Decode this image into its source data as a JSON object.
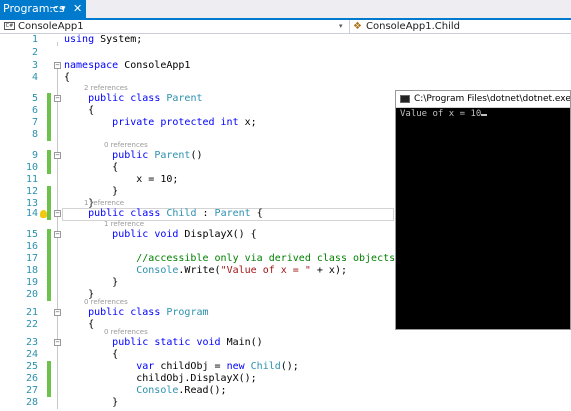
{
  "tab": {
    "label": "Program.cs",
    "pin": "ꟷ",
    "dropdown": "▾",
    "close": "✕"
  },
  "navbar": {
    "project": "ConsoleApp1",
    "member": "ConsoleApp1.Child",
    "arrow": "▾"
  },
  "editor": {
    "lines": [
      {
        "n": "1",
        "code": "using System;"
      },
      {
        "n": "2",
        "code": ""
      },
      {
        "n": "3",
        "code": "namespace ConsoleApp1"
      },
      {
        "n": "4",
        "code": "{"
      },
      {
        "n": "5",
        "code": "    public class Parent"
      },
      {
        "n": "6",
        "code": "    {"
      },
      {
        "n": "7",
        "code": "        private protected int x;"
      },
      {
        "n": "8",
        "code": ""
      },
      {
        "n": "9",
        "code": "        public Parent()"
      },
      {
        "n": "10",
        "code": "        {"
      },
      {
        "n": "11",
        "code": "            x = 10;"
      },
      {
        "n": "12",
        "code": "        }"
      },
      {
        "n": "13",
        "code": "    }"
      },
      {
        "n": "14",
        "code": "    public class Child : Parent {"
      },
      {
        "n": "15",
        "code": "        public void DisplayX() {"
      },
      {
        "n": "16",
        "code": ""
      },
      {
        "n": "17",
        "code": "            //accessible only via derived class objects"
      },
      {
        "n": "18",
        "code": "            Console.Write(\"Value of x = \" + x);"
      },
      {
        "n": "19",
        "code": "        }"
      },
      {
        "n": "20",
        "code": "    }"
      },
      {
        "n": "21",
        "code": "    public class Program"
      },
      {
        "n": "22",
        "code": "    {"
      },
      {
        "n": "23",
        "code": "        public static void Main()"
      },
      {
        "n": "24",
        "code": "        {"
      },
      {
        "n": "25",
        "code": "            var childObj = new Child();"
      },
      {
        "n": "26",
        "code": "            childObj.DisplayX();"
      },
      {
        "n": "27",
        "code": "            Console.Read();"
      },
      {
        "n": "28",
        "code": "        }"
      }
    ],
    "lenses": {
      "parent": "2 references",
      "parent_ctor": "0 references",
      "child": "1 reference",
      "displayx": "1 reference",
      "program": "0 references",
      "main": "0 references"
    }
  },
  "console": {
    "title": "C:\\Program Files\\dotnet\\dotnet.exe",
    "output": "Value of x = 10"
  },
  "colors": {
    "accent": "#007acc",
    "line_number": "#2b91af",
    "keyword": "#0000ff",
    "type": "#2b91af",
    "string": "#a31515",
    "comment": "#008000",
    "change_bar": "#6cc24a"
  }
}
